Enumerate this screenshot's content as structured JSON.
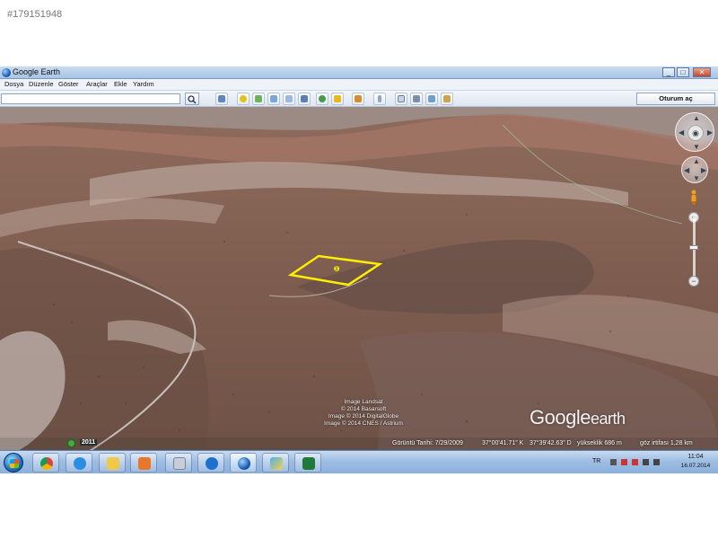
{
  "listing_id": "#179151948",
  "window": {
    "title": "Google Earth",
    "controls": {
      "minimize": "_",
      "maximize": "□",
      "close": "✕"
    }
  },
  "menu": [
    "Dosya",
    "Düzenle",
    "Göster",
    "Araçlar",
    "Ekle",
    "Yardım"
  ],
  "toolbar": {
    "search_value": "",
    "signin_label": "Oturum aç",
    "icons": [
      "sidebar-icon",
      "placemark-icon",
      "polygon-icon",
      "path-icon",
      "image-overlay-icon",
      "record-tour-icon",
      "historical-imagery-icon",
      "sun-icon",
      "planets-icon",
      "ruler-icon",
      "email-icon",
      "print-icon",
      "save-image-icon"
    ]
  },
  "map": {
    "parcel_label": "3",
    "watermark": {
      "main": "Google",
      "sub": "earth"
    },
    "credits": [
      "Image Landsat",
      "© 2014 Basarsoft",
      "Image © 2014 DigitalGlobe",
      "Image © 2014 CNES / Astrium"
    ],
    "status": {
      "year": "2011",
      "imagery_date": "Görüntü Tarihi: 7/29/2009",
      "lat": "37°00'41.71\" K",
      "lon": "37°39'42.63\" D",
      "elevation": "yükseklik  686 m",
      "eye_alt": "göz irtifası   1,28 km"
    },
    "parcel_color": "#ffee00"
  },
  "taskbar": {
    "apps": [
      "chrome",
      "internet-explorer",
      "file-explorer",
      "media-player",
      "calculator",
      "teamviewer",
      "google-earth",
      "paint",
      "excel"
    ],
    "language": "TR",
    "time": "11:04",
    "date": "16.07.2014"
  }
}
